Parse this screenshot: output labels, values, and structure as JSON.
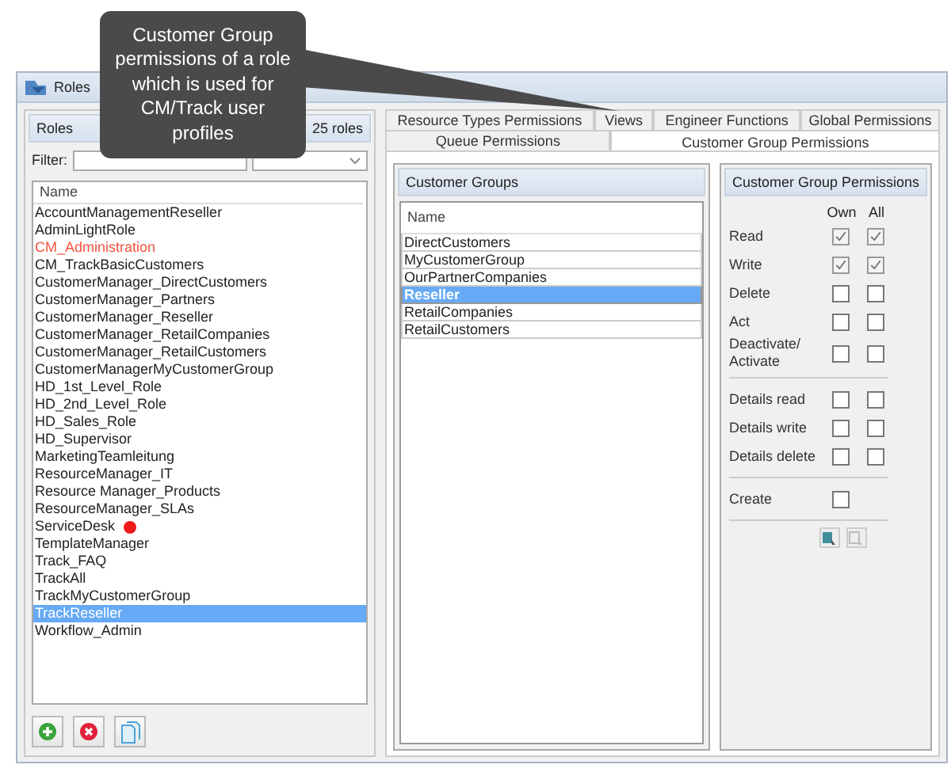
{
  "callout": {
    "text": "Customer Group permissions of a role which is used for CM/Track user profiles"
  },
  "window": {
    "title": "Roles"
  },
  "roles_panel": {
    "title": "Roles",
    "count": "25 roles",
    "filter_label": "Filter:",
    "column": "Name",
    "items": [
      {
        "name": "AccountManagementReseller",
        "selected": false,
        "highlighted": false
      },
      {
        "name": "AdminLightRole",
        "selected": false,
        "highlighted": false
      },
      {
        "name": "CM_Administration",
        "selected": false,
        "highlighted": true
      },
      {
        "name": "CM_TrackBasicCustomers",
        "selected": false,
        "highlighted": false
      },
      {
        "name": "CustomerManager_DirectCustomers",
        "selected": false,
        "highlighted": false
      },
      {
        "name": "CustomerManager_Partners",
        "selected": false,
        "highlighted": false
      },
      {
        "name": "CustomerManager_Reseller",
        "selected": false,
        "highlighted": false
      },
      {
        "name": "CustomerManager_RetailCompanies",
        "selected": false,
        "highlighted": false
      },
      {
        "name": "CustomerManager_RetailCustomers",
        "selected": false,
        "highlighted": false
      },
      {
        "name": "CustomerManagerMyCustomerGroup",
        "selected": false,
        "highlighted": false
      },
      {
        "name": "HD_1st_Level_Role",
        "selected": false,
        "highlighted": false
      },
      {
        "name": "HD_2nd_Level_Role",
        "selected": false,
        "highlighted": false
      },
      {
        "name": "HD_Sales_Role",
        "selected": false,
        "highlighted": false
      },
      {
        "name": "HD_Supervisor",
        "selected": false,
        "highlighted": false
      },
      {
        "name": "MarketingTeamleitung",
        "selected": false,
        "highlighted": false
      },
      {
        "name": "ResourceManager_IT",
        "selected": false,
        "highlighted": false
      },
      {
        "name": "Resource Manager_Products",
        "selected": false,
        "highlighted": false
      },
      {
        "name": "ResourceManager_SLAs",
        "selected": false,
        "highlighted": false
      },
      {
        "name": "ServiceDesk",
        "selected": false,
        "highlighted": false,
        "color": "#ee1c1c"
      },
      {
        "name": "TemplateManager",
        "selected": false,
        "highlighted": false
      },
      {
        "name": "Track_FAQ",
        "selected": false,
        "highlighted": false
      },
      {
        "name": "TrackAll",
        "selected": false,
        "highlighted": false
      },
      {
        "name": "TrackMyCustomerGroup",
        "selected": false,
        "highlighted": false
      },
      {
        "name": "TrackReseller",
        "selected": true,
        "highlighted": false
      },
      {
        "name": "Workflow_Admin",
        "selected": false,
        "highlighted": false
      }
    ]
  },
  "tabs": [
    [
      {
        "label": "Resource Types Permissions",
        "selected": false
      },
      {
        "label": "Views",
        "selected": false
      },
      {
        "label": "Engineer Functions",
        "selected": false
      },
      {
        "label": "Global Permissions",
        "selected": false
      }
    ],
    [
      {
        "label": "Queue Permissions",
        "selected": false
      },
      {
        "label": "Customer Group Permissions",
        "selected": true
      }
    ]
  ],
  "customer_groups": {
    "title": "Customer Groups",
    "column": "Name",
    "items": [
      {
        "name": "DirectCustomers",
        "selected": false
      },
      {
        "name": "MyCustomerGroup",
        "selected": false
      },
      {
        "name": "OurPartnerCompanies",
        "selected": false
      },
      {
        "name": "Reseller",
        "selected": true
      },
      {
        "name": "RetailCompanies",
        "selected": false
      },
      {
        "name": "RetailCustomers",
        "selected": false
      }
    ]
  },
  "permissions": {
    "title": "Customer Group Permissions",
    "columns": [
      "Own",
      "All"
    ],
    "sections": [
      [
        {
          "label": "Read",
          "own": true,
          "all": true
        },
        {
          "label": "Write",
          "own": true,
          "all": true
        },
        {
          "label": "Delete",
          "own": false,
          "all": false
        },
        {
          "label": "Act",
          "own": false,
          "all": false
        },
        {
          "label": "Deactivate/ Activate",
          "own": false,
          "all": false
        }
      ],
      [
        {
          "label": "Details read",
          "own": false,
          "all": false
        },
        {
          "label": "Details write",
          "own": false,
          "all": false
        },
        {
          "label": "Details delete",
          "own": false,
          "all": false
        }
      ],
      [
        {
          "label": "Create",
          "own": false
        }
      ]
    ]
  }
}
